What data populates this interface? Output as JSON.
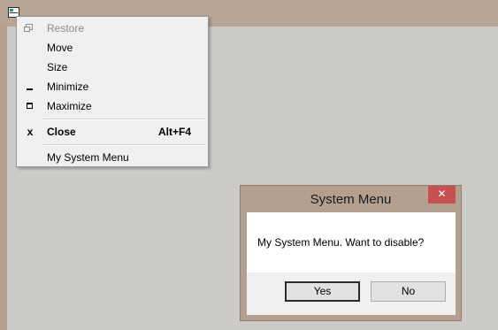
{
  "system_menu": {
    "items": [
      {
        "label": "Restore",
        "icon": "restore-icon",
        "disabled": true
      },
      {
        "label": "Move",
        "icon": "",
        "disabled": false
      },
      {
        "label": "Size",
        "icon": "",
        "disabled": false
      },
      {
        "label": "Minimize",
        "icon": "minimize-icon",
        "disabled": false
      },
      {
        "label": "Maximize",
        "icon": "maximize-icon",
        "disabled": false
      },
      {
        "label": "Close",
        "icon": "close-icon",
        "disabled": false,
        "accelerator": "Alt+F4",
        "bold": true
      },
      {
        "label": "My System Menu",
        "icon": "",
        "disabled": false
      }
    ],
    "close_glyph": "x"
  },
  "dialog": {
    "title": "System Menu",
    "close_glyph": "✕",
    "message": "My System Menu. Want to disable?",
    "yes_label": "Yes",
    "no_label": "No"
  },
  "colors": {
    "window_frame": "#b9a392",
    "client_area": "#cccbc8",
    "menu_background": "#f0f0f0",
    "dialog_close": "#c75050"
  }
}
